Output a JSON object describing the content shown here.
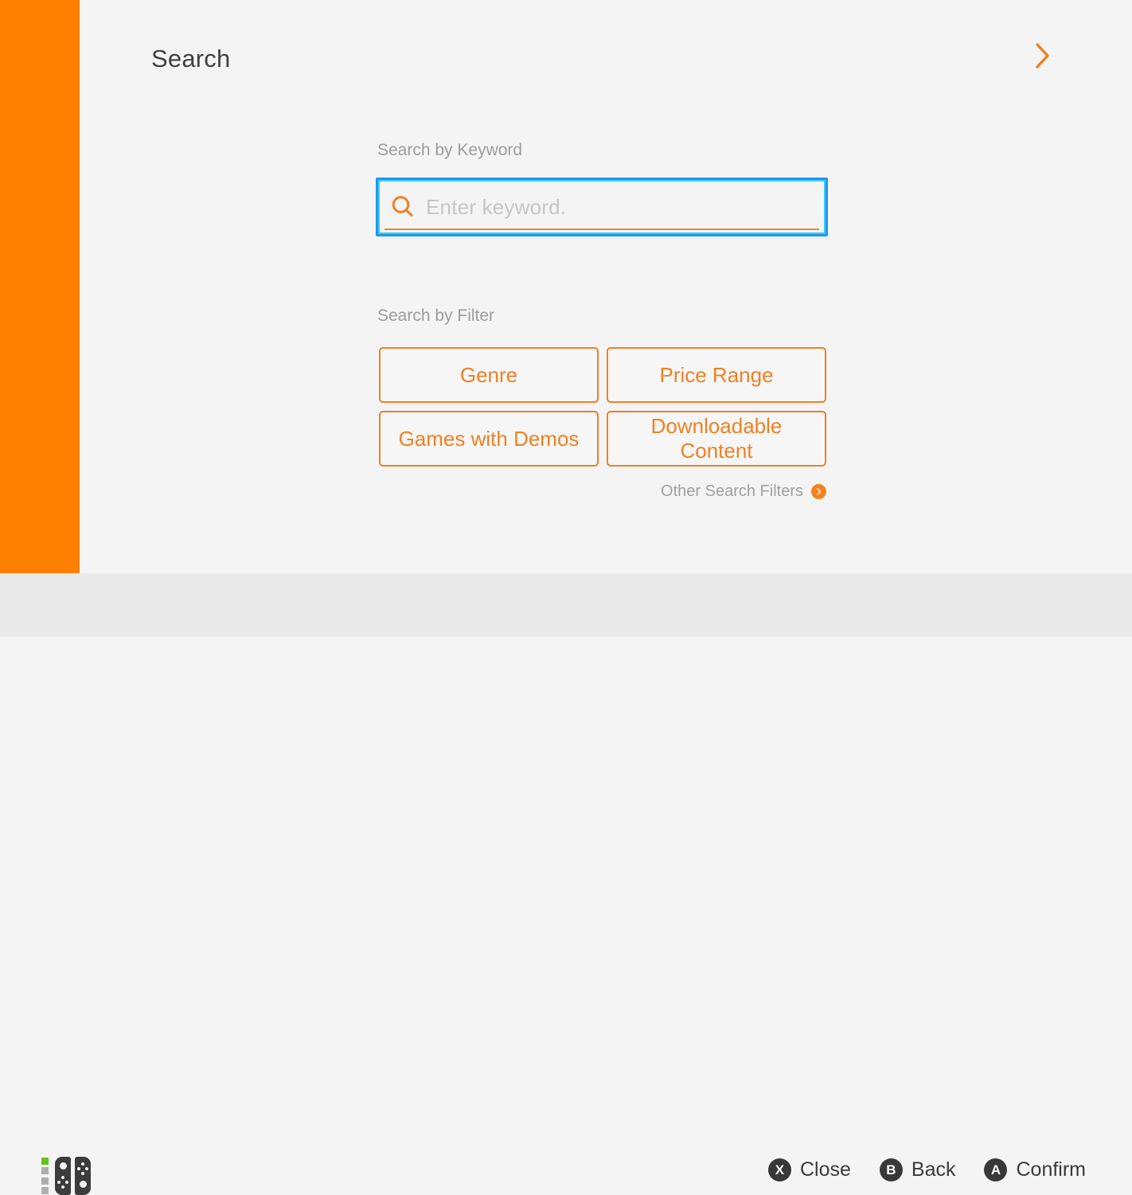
{
  "theme": {
    "accent_orange": "#ff8000",
    "button_orange": "#ef8022",
    "focus_blue": "#2196f0",
    "focus_cyan": "#35cdf7",
    "background": "#f4f4f4",
    "footer_background": "#e9e9e9"
  },
  "header": {
    "title": "Search",
    "next_icon": "chevron-right-icon"
  },
  "keyword_section": {
    "label": "Search by Keyword",
    "search_icon": "magnifier-icon",
    "input_value": "",
    "placeholder": "Enter keyword."
  },
  "filter_section": {
    "label": "Search by Filter",
    "buttons": [
      {
        "label": "Genre"
      },
      {
        "label": "Price Range"
      },
      {
        "label": "Games with Demos"
      },
      {
        "label": "Downloadable Content"
      }
    ],
    "other_filters": {
      "label": "Other Search Filters",
      "icon": "chevron-right-circle-icon"
    }
  },
  "footer": {
    "controller": {
      "icon": "joycon-controller-icon",
      "player_leds": [
        true,
        false,
        false,
        false
      ]
    },
    "hints": [
      {
        "button": "X",
        "label": "Close"
      },
      {
        "button": "B",
        "label": "Back"
      },
      {
        "button": "A",
        "label": "Confirm"
      }
    ]
  }
}
